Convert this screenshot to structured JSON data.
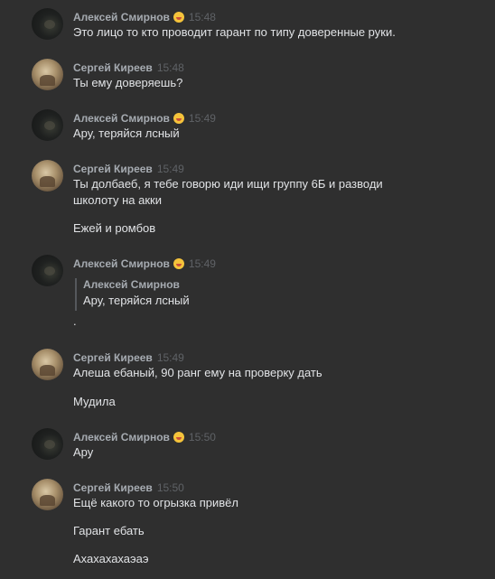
{
  "messages": [
    {
      "author": "Алексей Смирнов",
      "emoji": "drooling-face-emoji",
      "time": "15:48",
      "lines": [
        "Это лицо то кто проводит гарант по типу доверенные руки."
      ]
    },
    {
      "author": "Сергей Киреев",
      "time": "15:48",
      "lines": [
        "Ты ему доверяешь?"
      ]
    },
    {
      "author": "Алексей Смирнов",
      "emoji": "drooling-face-emoji",
      "time": "15:49",
      "lines": [
        "Ару, теряйся лсный"
      ]
    },
    {
      "author": "Сергей Киреев",
      "time": "15:49",
      "lines": [
        "Ты долбаеб, я тебе говорю иди ищи группу 6Б и разводи",
        "школоту на акки",
        "Ежей и ромбов"
      ]
    },
    {
      "author": "Алексей Смирнов",
      "emoji": "drooling-face-emoji",
      "time": "15:49",
      "quote": {
        "author": "Алексей Смирнов",
        "text": "Ару, теряйся лсный"
      },
      "lines": [
        "."
      ]
    },
    {
      "author": "Сергей Киреев",
      "time": "15:49",
      "lines": [
        "Алеша ебаный, 90 ранг ему на проверку дать",
        "Мудила"
      ]
    },
    {
      "author": "Алексей Смирнов",
      "emoji": "drooling-face-emoji",
      "time": "15:50",
      "lines": [
        "Ару"
      ]
    },
    {
      "author": "Сергей Киреев",
      "time": "15:50",
      "lines": [
        "Ещё какого то огрызка привёл",
        "Гарант ебать",
        "Ахахахахаэаэ"
      ]
    }
  ]
}
